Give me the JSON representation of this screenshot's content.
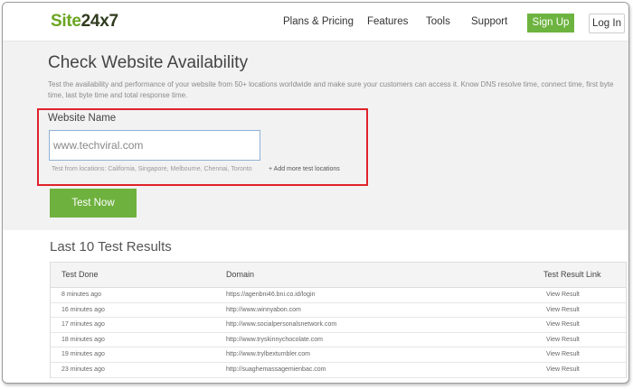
{
  "header": {
    "logo_part1": "Site",
    "logo_part2": "24x7",
    "nav": [
      "Plans & Pricing",
      "Features",
      "Tools",
      "Support"
    ],
    "signup_label": "Sign Up",
    "login_label": "Log In"
  },
  "hero": {
    "title": "Check Website Availability",
    "description": "Test the availability and performance of your website from 50+ locations worldwide and make sure your customers can access it. Know DNS resolve time, connect time, first byte time, last byte time and total response time.",
    "field_label": "Website Name",
    "input_value": "www.techviral.com",
    "locations_text": "Test from locations: California, Singapore, Melbourne, Chennai, Toronto",
    "add_locations": "+ Add more test locations",
    "test_button": "Test Now"
  },
  "results": {
    "title": "Last 10 Test Results",
    "columns": [
      "Test Done",
      "Domain",
      "Test Result Link"
    ],
    "rows": [
      {
        "time": "8 minutes ago",
        "domain": "https://agenbni46.bni.co.id/login",
        "link": "View Result"
      },
      {
        "time": "16 minutes ago",
        "domain": "http://www.winnyabon.com",
        "link": "View Result"
      },
      {
        "time": "17 minutes ago",
        "domain": "http://www.socialpersonalsnetwork.com",
        "link": "View Result"
      },
      {
        "time": "18 minutes ago",
        "domain": "http://www.tryskinnychocolate.com",
        "link": "View Result"
      },
      {
        "time": "19 minutes ago",
        "domain": "http://www.trylbextumbler.com",
        "link": "View Result"
      },
      {
        "time": "23 minutes ago",
        "domain": "http://suaghemassagemienbac.com",
        "link": "View Result"
      }
    ]
  },
  "colors": {
    "brand_green": "#6aa521",
    "button_green": "#6fb13e",
    "highlight_red": "#e0232b"
  }
}
